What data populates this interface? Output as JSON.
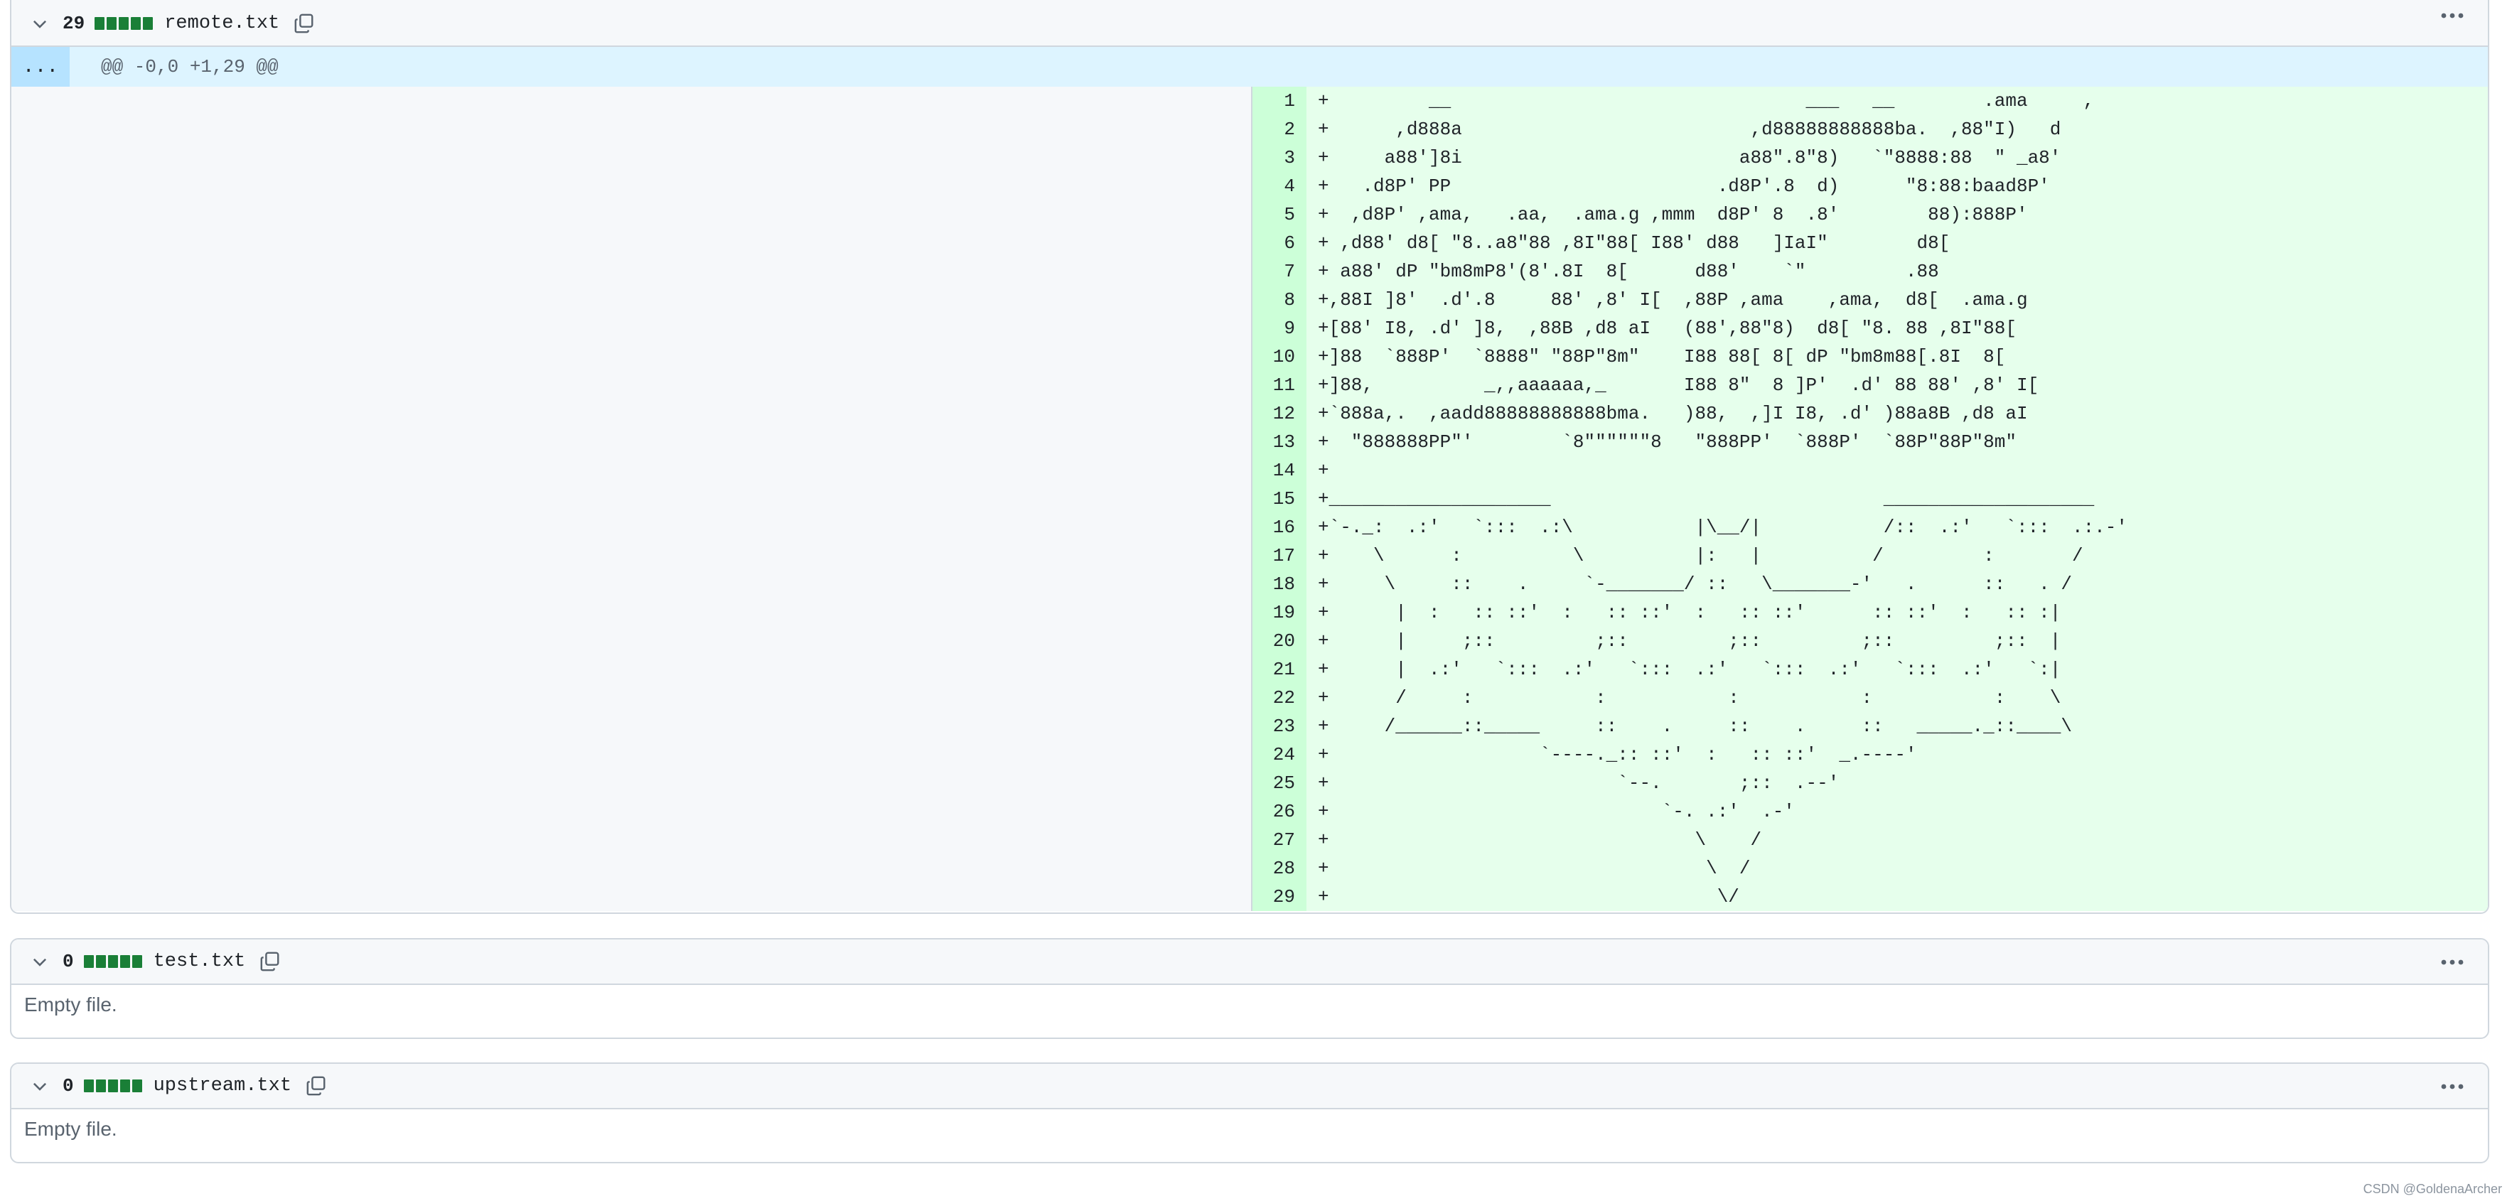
{
  "files": [
    {
      "count": "29",
      "name": "remote.txt",
      "hunk": "@@ -0,0 +1,29 @@",
      "expand_label": "...",
      "lines": [
        {
          "no": "1",
          "text": "+         __                                ___   __        .ama     ,"
        },
        {
          "no": "2",
          "text": "+      ,d888a                          ,d88888888888ba.  ,88\"I)   d"
        },
        {
          "no": "3",
          "text": "+     a88']8i                         a88\".8\"8)   `\"8888:88  \" _a8'"
        },
        {
          "no": "4",
          "text": "+   .d8P' PP                        .d8P'.8  d)      \"8:88:baad8P'"
        },
        {
          "no": "5",
          "text": "+  ,d8P' ,ama,   .aa,  .ama.g ,mmm  d8P' 8  .8'        88):888P'"
        },
        {
          "no": "6",
          "text": "+ ,d88' d8[ \"8..a8\"88 ,8I\"88[ I88' d88   ]IaI\"        d8["
        },
        {
          "no": "7",
          "text": "+ a88' dP \"bm8mP8'(8'.8I  8[      d88'    `\"         .88"
        },
        {
          "no": "8",
          "text": "+,88I ]8'  .d'.8     88' ,8' I[  ,88P ,ama    ,ama,  d8[  .ama.g"
        },
        {
          "no": "9",
          "text": "+[88' I8, .d' ]8,  ,88B ,d8 aI   (88',88\"8)  d8[ \"8. 88 ,8I\"88["
        },
        {
          "no": "10",
          "text": "+]88  `888P'  `8888\" \"88P\"8m\"    I88 88[ 8[ dP \"bm8m88[.8I  8["
        },
        {
          "no": "11",
          "text": "+]88,          _,,aaaaaa,_       I88 8\"  8 ]P'  .d' 88 88' ,8' I["
        },
        {
          "no": "12",
          "text": "+`888a,.  ,aadd88888888888bma.   )88,  ,]I I8, .d' )88a8B ,d8 aI"
        },
        {
          "no": "13",
          "text": "+  \"888888PP\"'        `8\"\"\"\"\"\"8   \"888PP'  `888P'  `88P\"88P\"8m\""
        },
        {
          "no": "14",
          "text": "+"
        },
        {
          "no": "15",
          "text": "+____________________                              ___________________"
        },
        {
          "no": "16",
          "text": "+`-._:  .:'   `:::  .:\\           |\\__/|           /::  .:'   `:::  .:.-'"
        },
        {
          "no": "17",
          "text": "+    \\      :          \\          |:   |          /         :       /"
        },
        {
          "no": "18",
          "text": "+     \\     ::    .     `-_______/ ::   \\_______-'   .      ::   . /"
        },
        {
          "no": "19",
          "text": "+      |  :   :: ::'  :   :: ::'  :   :: ::'      :: ::'  :   :: :|"
        },
        {
          "no": "20",
          "text": "+      |     ;::         ;::         ;::         ;::         ;::  |"
        },
        {
          "no": "21",
          "text": "+      |  .:'   `:::  .:'   `:::  .:'   `:::  .:'   `:::  .:'   `:|"
        },
        {
          "no": "22",
          "text": "+      /     :           :           :           :           :    \\"
        },
        {
          "no": "23",
          "text": "+     /______::_____     ::    .     ::    .     ::   _____._::____\\"
        },
        {
          "no": "24",
          "text": "+                   `----._:: ::'  :   :: ::'  _.----'"
        },
        {
          "no": "25",
          "text": "+                          `--.       ;::  .--'"
        },
        {
          "no": "26",
          "text": "+                              `-. .:'  .-'"
        },
        {
          "no": "27",
          "text": "+                                 \\    /"
        },
        {
          "no": "28",
          "text": "+                                  \\  /"
        },
        {
          "no": "29",
          "text": "+                                   \\/"
        }
      ]
    },
    {
      "count": "0",
      "name": "test.txt",
      "note": "Empty file."
    },
    {
      "count": "0",
      "name": "upstream.txt",
      "note": "Empty file."
    }
  ],
  "footer": "CSDN @GoldenaArcher",
  "colors": {
    "add_bg": "#e6ffec",
    "add_num_bg": "#ccffd8",
    "hunk_bg": "#ddf4ff",
    "diffstat_green": "#1a7f37"
  }
}
